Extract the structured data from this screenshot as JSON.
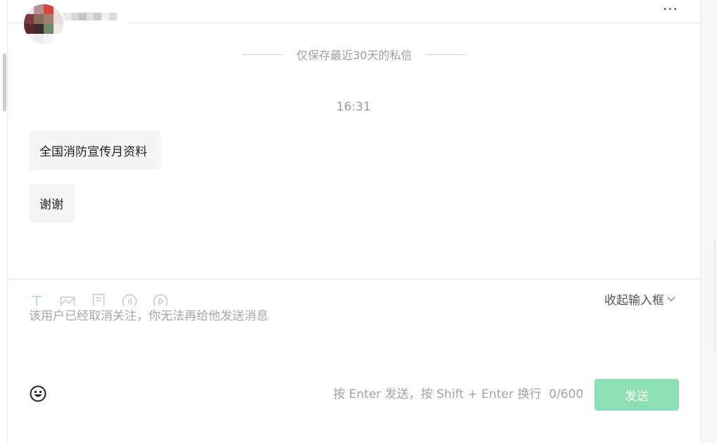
{
  "header": {
    "more_label": "···"
  },
  "notice": {
    "text": "仅保存最近30天的私信"
  },
  "messages": {
    "time": "16:31",
    "items": [
      {
        "text": "全国消防宣传月资料"
      },
      {
        "text": "谢谢"
      }
    ]
  },
  "composer": {
    "tools": [
      "text-icon",
      "image-icon",
      "document-icon",
      "audio-icon",
      "video-icon"
    ],
    "collapse_label": "收起输入框",
    "disabled_message": "该用户已经取消关注，你无法再给他发送消息",
    "hint": "按 Enter 发送，按 Shift + Enter 换行",
    "counter": "0/600",
    "send_label": "发送"
  },
  "colors": {
    "send_disabled": "#8de0b2",
    "bubble_bg": "#f4f5f7",
    "muted_text": "#a3a3a3"
  }
}
